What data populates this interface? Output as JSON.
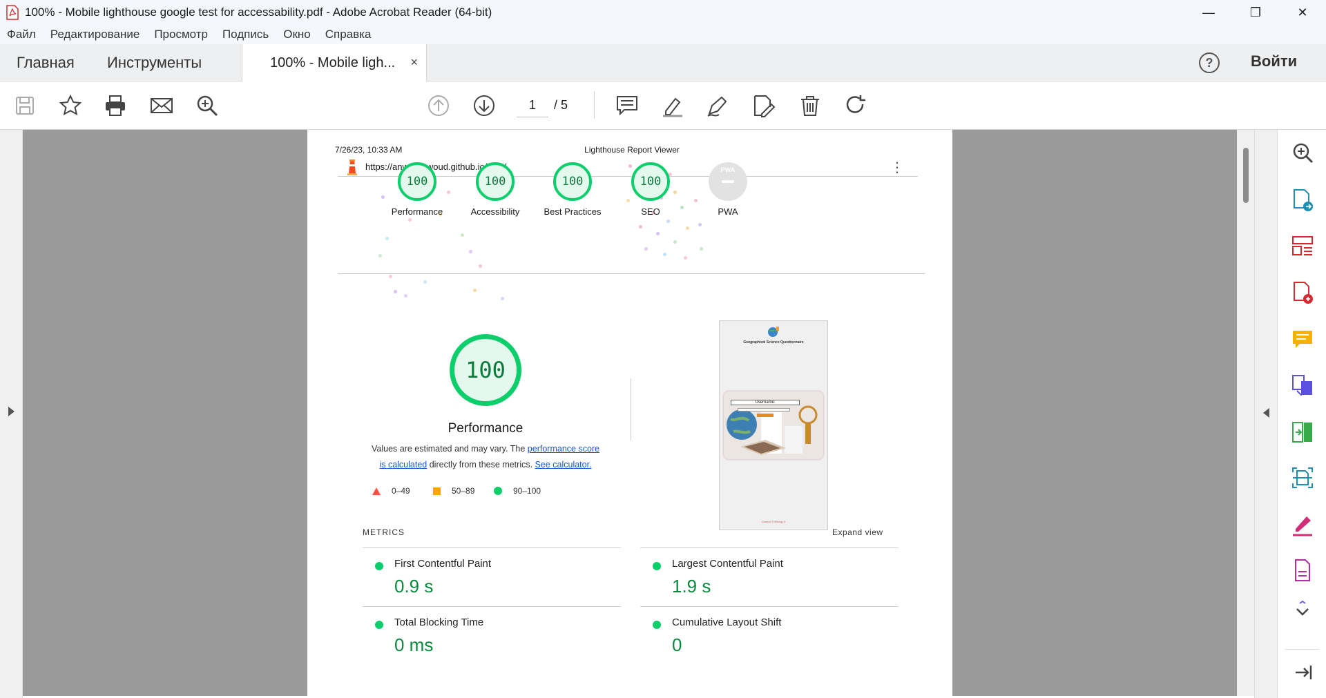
{
  "window": {
    "title": "100% - Mobile lighthouse google test for accessability.pdf - Adobe Acrobat Reader (64-bit)",
    "minimize": "—",
    "maximize": "❐",
    "close": "✕"
  },
  "menu": [
    "Файл",
    "Редактирование",
    "Просмотр",
    "Подпись",
    "Окно",
    "Справка"
  ],
  "tabs": {
    "home": "Главная",
    "tools": "Инструменты",
    "document": "100% - Mobile ligh...",
    "close": "×",
    "help": "?",
    "login": "Войти"
  },
  "toolbar": {
    "page_current": "1",
    "page_total": "/  5"
  },
  "report": {
    "date": "7/26/23, 10:33 AM",
    "viewer_title": "Lighthouse Report Viewer",
    "url": "https://anwardawoud.github.io/PP2/",
    "more": "⋮",
    "scores": [
      {
        "value": "100",
        "label": "Performance"
      },
      {
        "value": "100",
        "label": "Accessibility"
      },
      {
        "value": "100",
        "label": "Best Practices"
      },
      {
        "value": "100",
        "label": "SEO"
      }
    ],
    "pwa_label": "PWA",
    "pwa_badge": "PWA",
    "main_score": "100",
    "main_title": "Performance",
    "desc_text1": "Values are estimated and may vary. The ",
    "desc_link1": "performance score is calculated",
    "desc_text2": " directly from these metrics. ",
    "desc_link2": "See calculator.",
    "legend": [
      "0–49",
      "50–89",
      "90–100"
    ],
    "screenshot": {
      "heading": "Geographical Science Questionnaire",
      "username_label": "Username:",
      "footer": "Correct: 0    Wrong: 0"
    },
    "metrics_heading": "METRICS",
    "expand_view": "Expand view",
    "metrics": [
      {
        "name": "First Contentful Paint",
        "value": "0.9 s"
      },
      {
        "name": "Largest Contentful Paint",
        "value": "1.9 s"
      },
      {
        "name": "Total Blocking Time",
        "value": "0 ms"
      },
      {
        "name": "Cumulative Layout Shift",
        "value": "0"
      }
    ]
  },
  "colors": {
    "pass": "#0cce6b",
    "average": "#ffa400",
    "fail": "#ff4e42",
    "viewer_bg": "#9a9a9a"
  }
}
